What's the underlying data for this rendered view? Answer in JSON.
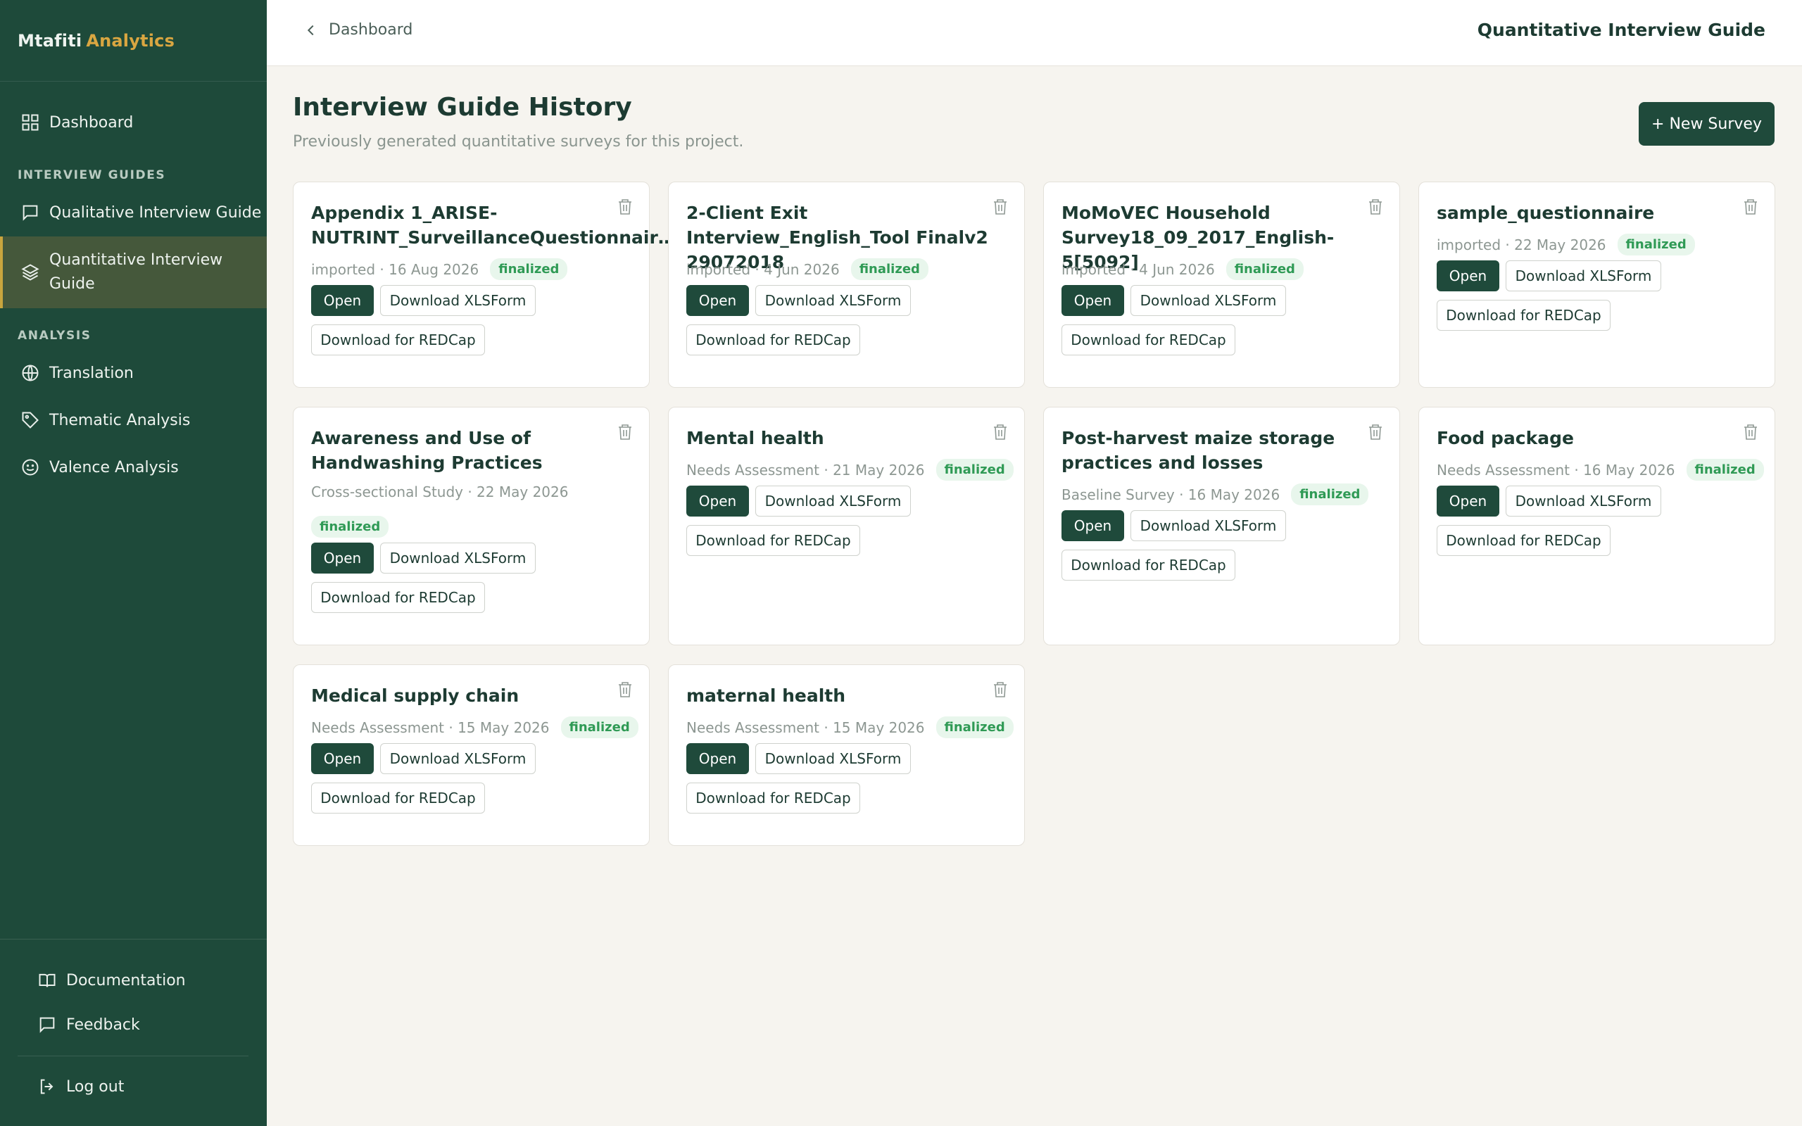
{
  "brand": {
    "name": "Mtafiti",
    "accent": "Analytics"
  },
  "sidebar": {
    "dashboard": "Dashboard",
    "section_guides": "INTERVIEW GUIDES",
    "qualitative": "Qualitative Interview Guide",
    "quantitative_line1": "Quantitative Interview",
    "quantitative_line2": "Guide",
    "section_analysis": "ANALYSIS",
    "translation": "Translation",
    "thematic": "Thematic Analysis",
    "valence": "Valence Analysis",
    "documentation": "Documentation",
    "feedback": "Feedback",
    "logout": "Log out"
  },
  "topbar": {
    "breadcrumb": "Dashboard",
    "title": "Quantitative Interview Guide"
  },
  "main": {
    "title": "Interview Guide History",
    "subtitle": "Previously generated quantitative surveys for this project.",
    "new_survey": "+ New Survey"
  },
  "buttons": {
    "open": "Open",
    "xlsform": "Download XLSForm",
    "redcap": "Download for REDCap"
  },
  "cards": [
    {
      "title": "Appendix 1_ARISE-NUTRINT_SurveillanceQuestionnair…",
      "meta": "imported · 16 Aug 2026",
      "status": "finalized"
    },
    {
      "title": "2-Client Exit Interview_English_Tool Finalv2 29072018",
      "meta": "imported · 4 Jun 2026",
      "status": "finalized"
    },
    {
      "title": "MoMoVEC Household Survey18_09_2017_English-5[5092]",
      "meta": "imported · 4 Jun 2026",
      "status": "finalized"
    },
    {
      "title": "sample_questionnaire",
      "meta": "imported · 22 May 2026",
      "status": "finalized"
    },
    {
      "title": "Awareness and Use of Handwashing Practices",
      "meta": "Cross-sectional Study · 22 May 2026",
      "status": "finalized"
    },
    {
      "title": "Mental health",
      "meta": "Needs Assessment · 21 May 2026",
      "status": "finalized"
    },
    {
      "title": "Post-harvest maize storage practices and losses",
      "meta": "Baseline Survey · 16 May 2026",
      "status": "finalized"
    },
    {
      "title": "Food package",
      "meta": "Needs Assessment · 16 May 2026",
      "status": "finalized"
    },
    {
      "title": "Medical supply chain",
      "meta": "Needs Assessment · 15 May 2026",
      "status": "finalized"
    },
    {
      "title": "maternal health",
      "meta": "Needs Assessment · 15 May 2026",
      "status": "finalized"
    }
  ],
  "colors": {
    "sidebar": "#1e4a3a",
    "accent": "#d9a641",
    "primary_button": "#1f4a3b",
    "badge_text": "#2f9a55",
    "badge_bg": "#e8f6ec"
  }
}
